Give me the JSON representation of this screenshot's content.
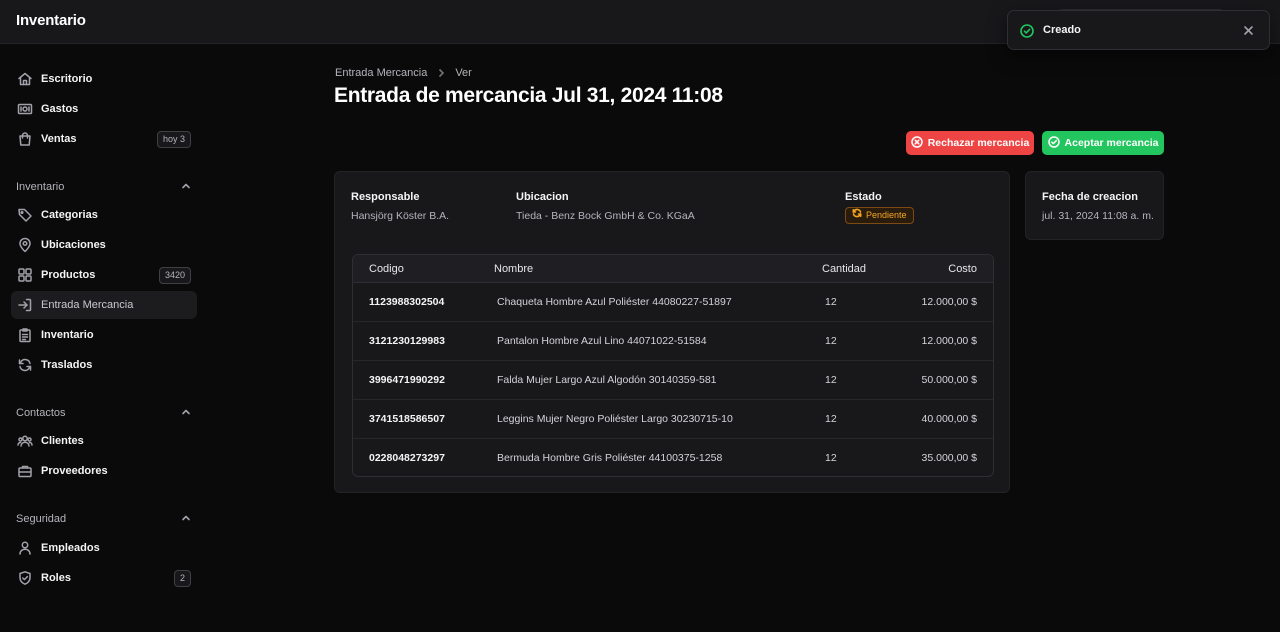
{
  "app": {
    "title": "Inventario"
  },
  "colors": {
    "background": "#0a0a0b",
    "panel": "#18181b",
    "danger": "#ef4444",
    "success": "#22c55e",
    "warning": "#f5a524"
  },
  "sidebar": {
    "top_items": [
      {
        "label": "Escritorio",
        "icon": "home-icon"
      },
      {
        "label": "Gastos",
        "icon": "banknote-icon"
      },
      {
        "label": "Ventas",
        "icon": "shopping-bag-icon",
        "badge": "hoy 3"
      }
    ],
    "groups": [
      {
        "title": "Inventario",
        "items": [
          {
            "label": "Categorias",
            "icon": "tag-icon"
          },
          {
            "label": "Ubicaciones",
            "icon": "map-pin-icon"
          },
          {
            "label": "Productos",
            "icon": "grid-icon",
            "badge": "3420"
          },
          {
            "label": "Entrada Mercancia",
            "icon": "log-in-icon",
            "active": true
          },
          {
            "label": "Inventario",
            "icon": "clipboard-list-icon"
          },
          {
            "label": "Traslados",
            "icon": "refresh-icon"
          }
        ]
      },
      {
        "title": "Contactos",
        "items": [
          {
            "label": "Clientes",
            "icon": "users-icon"
          },
          {
            "label": "Proveedores",
            "icon": "briefcase-icon"
          }
        ]
      },
      {
        "title": "Seguridad",
        "items": [
          {
            "label": "Empleados",
            "icon": "user-icon"
          },
          {
            "label": "Roles",
            "icon": "shield-icon",
            "badge": "2"
          }
        ]
      }
    ]
  },
  "breadcrumb": {
    "parent": "Entrada Mercancia",
    "current": "Ver"
  },
  "page": {
    "title": "Entrada de mercancia Jul 31, 2024 11:08"
  },
  "actions": {
    "reject_label": "Rechazar mercancia",
    "accept_label": "Aceptar mercancia"
  },
  "details": {
    "responsable_label": "Responsable",
    "responsable_value": "Hansjörg Köster B.A.",
    "ubicacion_label": "Ubicacion",
    "ubicacion_value": "Tieda - Benz Bock GmbH & Co. KGaA",
    "estado_label": "Estado",
    "estado_value": "Pendiente"
  },
  "meta": {
    "creacion_label": "Fecha de creacion",
    "creacion_value": "jul. 31, 2024 11:08 a. m."
  },
  "table": {
    "headers": {
      "code": "Codigo",
      "name": "Nombre",
      "qty": "Cantidad",
      "cost": "Costo"
    },
    "rows": [
      {
        "code": "1123988302504",
        "name": "Chaqueta Hombre Azul Poliéster 44080227-51897",
        "qty": "12",
        "cost": "12.000,00 $"
      },
      {
        "code": "3121230129983",
        "name": "Pantalon Hombre Azul Lino 44071022-51584",
        "qty": "12",
        "cost": "12.000,00 $"
      },
      {
        "code": "3996471990292",
        "name": "Falda Mujer Largo Azul Algodón 30140359-581",
        "qty": "12",
        "cost": "50.000,00 $"
      },
      {
        "code": "3741518586507",
        "name": "Leggins Mujer Negro Poliéster Largo 30230715-10",
        "qty": "12",
        "cost": "40.000,00 $"
      },
      {
        "code": "0228048273297",
        "name": "Bermuda Hombre Gris Poliéster 44100375-1258",
        "qty": "12",
        "cost": "35.000,00 $"
      }
    ]
  },
  "toast": {
    "message": "Creado",
    "icon": "check-circle-icon"
  }
}
